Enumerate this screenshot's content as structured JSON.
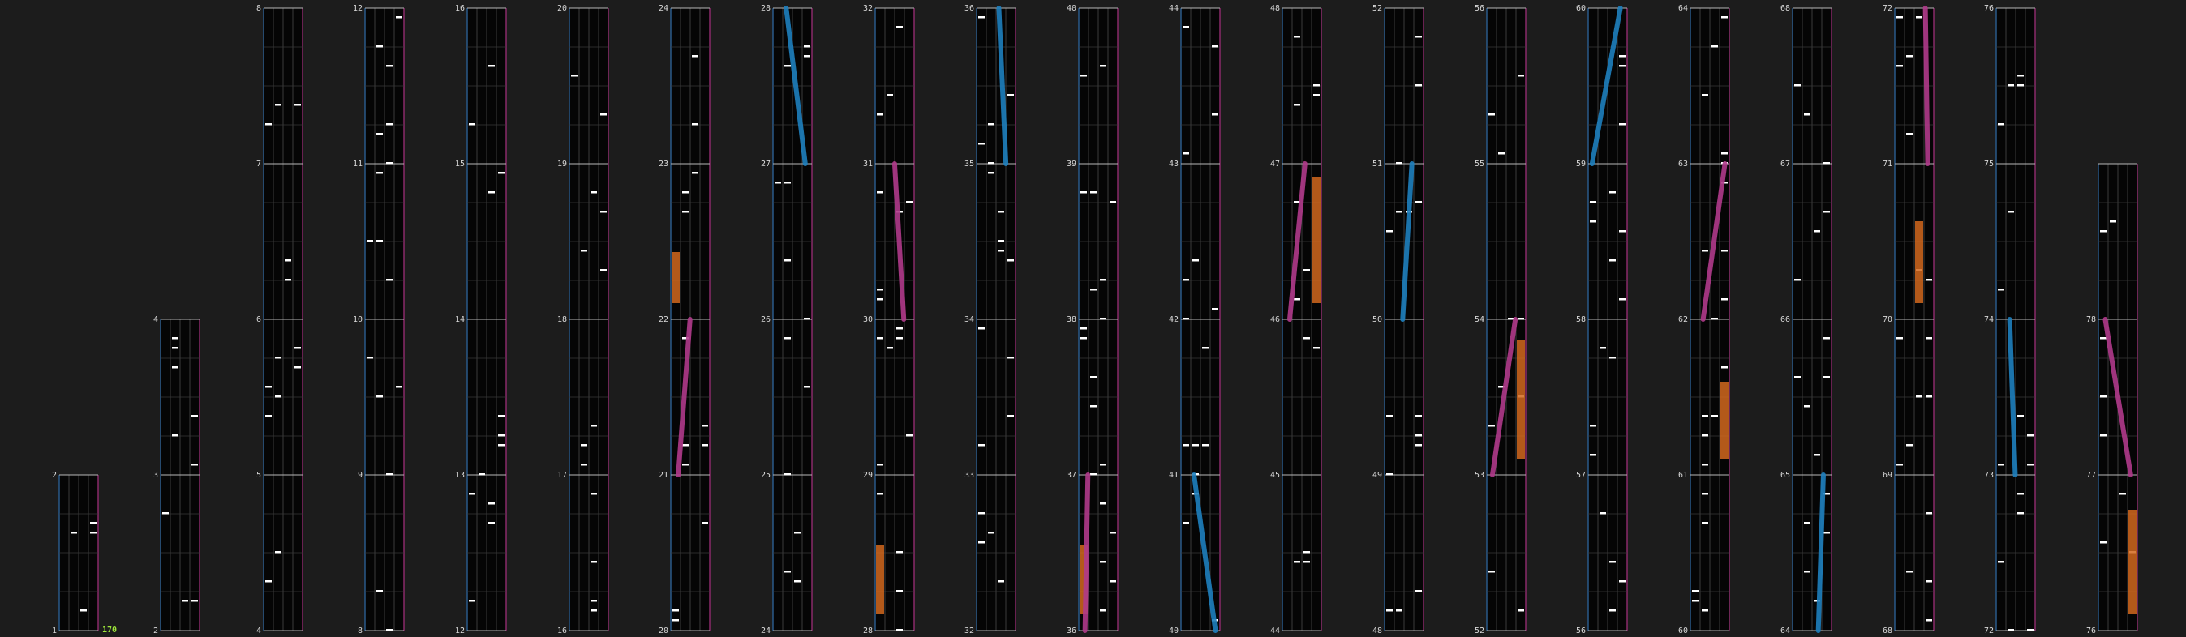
{
  "app": {
    "bpm": "170",
    "first_measure": 1,
    "last_measure": 78
  },
  "palette": {
    "background": "#1c1c1c",
    "lane_bg": "#050505",
    "lane_border_left": "#2a5a8a",
    "lane_border_right": "#8a2a6a",
    "grid_line": "#3a3a3a",
    "measure_line": "#b8b8b8",
    "note": "#ffffff",
    "long_note": "#d2691e",
    "slide_blue": "#1e7fbd",
    "slide_pink": "#b03a8a",
    "bpm_text": "#9ee63a"
  },
  "columns": [
    {
      "start": 1
    },
    {
      "start": 2
    },
    {
      "start": 4
    },
    {
      "start": 8
    },
    {
      "start": 12
    },
    {
      "start": 16
    },
    {
      "start": 20
    },
    {
      "start": 24
    },
    {
      "start": 28
    },
    {
      "start": 32
    },
    {
      "start": 36
    },
    {
      "start": 40
    },
    {
      "start": 44
    },
    {
      "start": 48
    },
    {
      "start": 52
    },
    {
      "start": 56
    },
    {
      "start": 60
    },
    {
      "start": 64
    },
    {
      "start": 68
    },
    {
      "start": 72
    },
    {
      "start": 76
    }
  ]
}
